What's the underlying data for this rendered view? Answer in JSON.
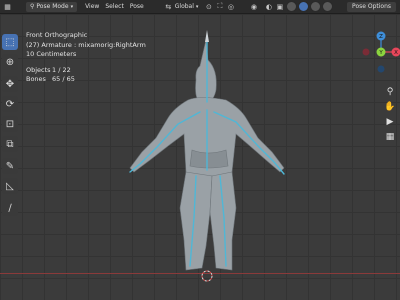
{
  "header": {
    "mode": "Pose Mode",
    "menus": [
      "View",
      "Select",
      "Pose"
    ],
    "transform_orientation": "Global",
    "pose_options": "Pose Options"
  },
  "overlay": {
    "view_name": "Front Orthographic",
    "active_object": "(27) Armature : mixamorig:RightArm",
    "grid_scale": "10 Centimeters",
    "objects_label": "Objects",
    "objects_value": "1 / 22",
    "bones_label": "Bones",
    "bones_value": "65 / 65"
  },
  "gizmo": {
    "z_label": "Z",
    "x_label": "X",
    "y_label": "Y",
    "colors": {
      "x": "#e8465a",
      "y": "#8bd43f",
      "z": "#3e8ed9"
    }
  },
  "toolbar": {
    "tools": [
      "select-box",
      "cursor",
      "move",
      "rotate",
      "scale",
      "transform",
      "annotate",
      "measure",
      "bone-tool"
    ]
  },
  "colors": {
    "viewport_bg": "#3b3b3b",
    "active_tool": "#4772b3",
    "bone_highlight": "#4fb7d6",
    "mesh": "#9aa1a6"
  }
}
